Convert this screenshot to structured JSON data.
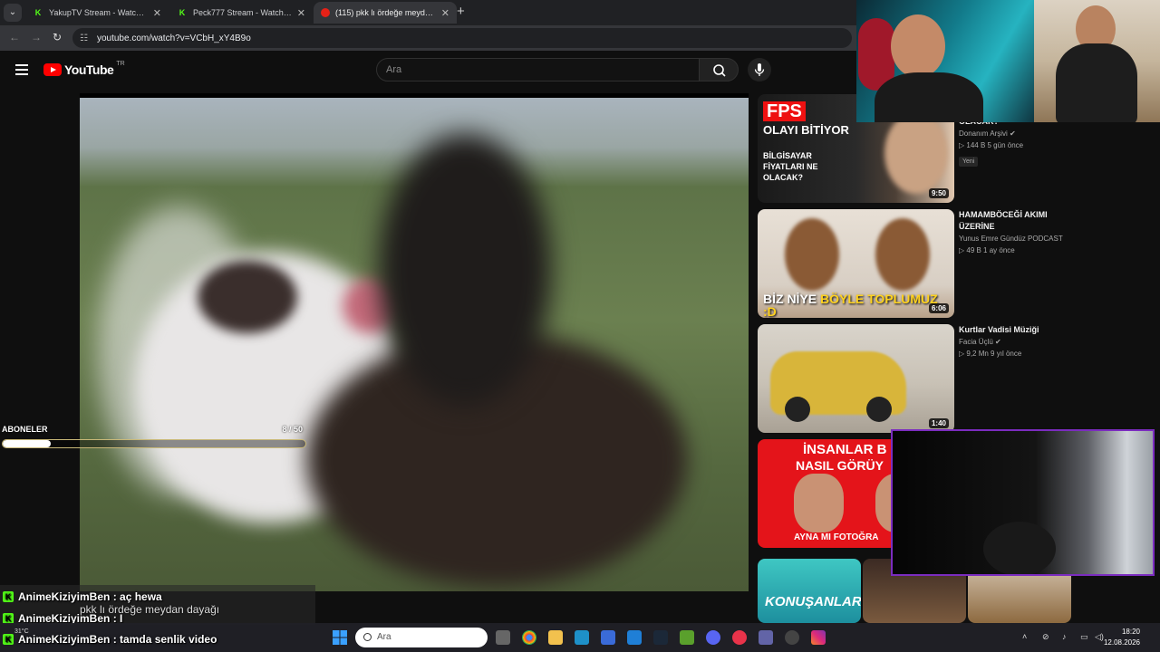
{
  "browser": {
    "tabs": [
      {
        "title": "YakupTV Stream - Watch Live o",
        "favicon": "kick-icon"
      },
      {
        "title": "Peck777 Stream - Watch Live o",
        "favicon": "kick-icon"
      },
      {
        "title": "(115) pkk lı ördeğe meydan da",
        "favicon": "youtube-icon"
      }
    ],
    "url": "youtube.com/watch?v=VCbH_xY4B9o"
  },
  "youtube": {
    "logo_text": "YouTube",
    "country": "TR",
    "search_placeholder": "Ara"
  },
  "subscriber_goal": {
    "label": "ABONELER",
    "count_text": "8 / 50",
    "current": 8,
    "goal": 50
  },
  "recommendations": [
    {
      "thumb_text_1": "FPS",
      "thumb_text_2": "OLAYI BİTİYOR",
      "thumb_text_3": "BİLGİSAYAR FİYATLARI NE OLACAK?",
      "title": "OLACAK?",
      "channel": "Donanım Arşivi",
      "verified": true,
      "stats": "▷ 144 B  5 gün önce",
      "badge": "Yeni",
      "duration": "9:50"
    },
    {
      "thumb_text_1": "BİZ NİYE",
      "thumb_text_2": "BÖYLE TOPLUMUZ :D",
      "title": "HAMAMBÖCEĞİ AKIMI ÜZERİNE",
      "channel": "Yunus Emre Gündüz PODCAST",
      "stats": "▷ 49 B  1 ay önce",
      "duration": "6:06"
    },
    {
      "title": "Kurtlar Vadisi Müziği",
      "channel": "Facia Üçlü",
      "verified": true,
      "stats": "▷ 9,2 Mn  9 yıl önce",
      "duration": "1:40"
    },
    {
      "thumb_text_1": "İNSANLAR B",
      "thumb_text_2": "NASIL GÖRÜY",
      "thumb_text_3": "AYNA MI FOTOĞRA"
    },
    {
      "thumb_text_1": "KONUŞANLAR"
    }
  ],
  "chat": [
    {
      "user": "AnimeKiziyimBen",
      "message": "aç hewa"
    },
    {
      "user": "AnimeKiziyimBen",
      "message": "I"
    },
    {
      "user": "AnimeKiziyimBen",
      "message": "tamda senlik video"
    }
  ],
  "caption": "pkk lı ördeğe meydan dayağı",
  "taskbar": {
    "search_placeholder": "Ara",
    "time": "18:20",
    "date": "12.08.2026",
    "weather": "31°C"
  },
  "colors": {
    "youtube_red": "#ff0000",
    "kick_green": "#53fc18",
    "cam_border": "#7b2cbf"
  }
}
